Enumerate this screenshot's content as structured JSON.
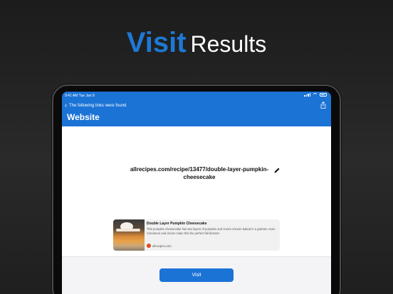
{
  "headline": {
    "accent": "Visit",
    "rest": "Results"
  },
  "status_bar": {
    "time": "9:41 AM  Tue Jan 9"
  },
  "nav": {
    "back_label": "The following links were found",
    "title": "Website",
    "share_icon": "share-icon"
  },
  "url": {
    "text": "allrecipes.com/recipe/13477/double-layer-pumpkin-cheesecake",
    "edit_icon": "pencil-icon"
  },
  "preview": {
    "title": "Double Layer Pumpkin Cheesecake",
    "description": "This pumpkin cheesecake has two layers of pumpkin and cream cheese baked in a graham crust. Cinnamon and cloves make this the perfect fall dessert.",
    "source": "allrecipes.com"
  },
  "actions": {
    "visit_label": "Visit"
  },
  "colors": {
    "accent": "#1b73d6",
    "headline_accent": "#1e78d4",
    "background": "#222222"
  }
}
